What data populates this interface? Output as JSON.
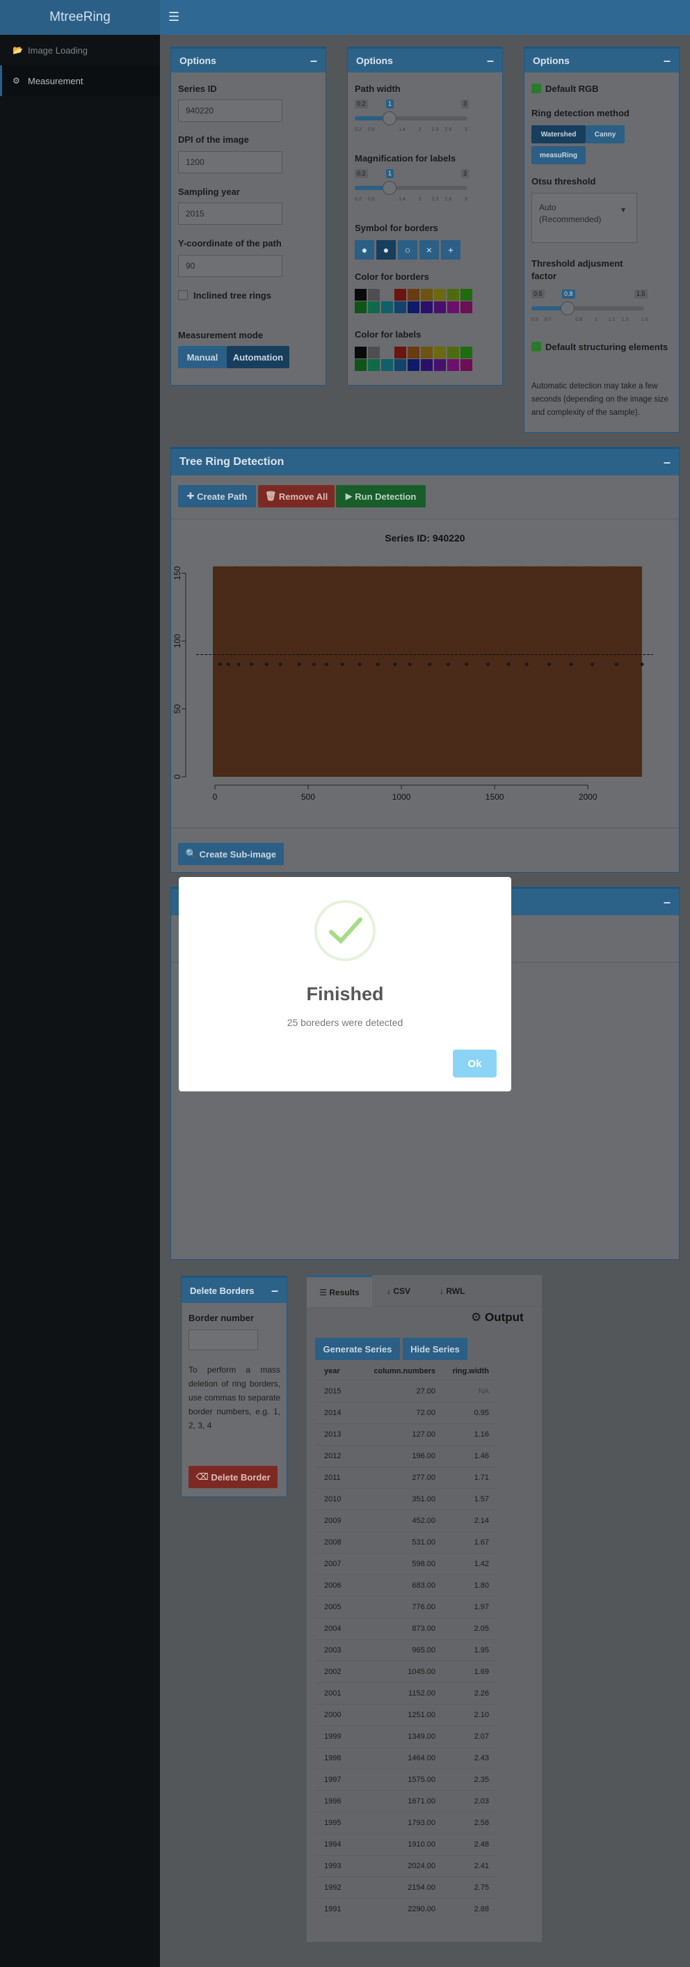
{
  "app": {
    "title": "MtreeRing"
  },
  "sidebar": {
    "items": [
      {
        "label": "Image Loading",
        "icon": "folder-open-icon"
      },
      {
        "label": "Measurement",
        "icon": "gear-icon"
      }
    ]
  },
  "options1": {
    "title": "Options",
    "series_id_label": "Series ID",
    "series_id": "940220",
    "dpi_label": "DPI of the image",
    "dpi": "1200",
    "year_label": "Sampling year",
    "year": "2015",
    "ycoord_label": "Y-coordinate of the path",
    "ycoord": "90",
    "inclined_label": "Inclined tree rings",
    "mode_label": "Measurement mode",
    "mode_manual": "Manual",
    "mode_auto": "Automation"
  },
  "options2": {
    "title": "Options",
    "path_width_label": "Path width",
    "pw_min": "0.2",
    "pw_val": "1",
    "pw_max": "3",
    "pw_ticks": [
      "0.2",
      "0.5",
      "1.4",
      "2",
      "2.3",
      "2.6",
      "3"
    ],
    "mag_label": "Magnification for labels",
    "mag_min": "0.2",
    "mag_val": "1",
    "mag_max": "3",
    "mag_ticks": [
      "0.2",
      "0.5",
      "1.4",
      "2",
      "2.3",
      "2.6",
      "3"
    ],
    "symbol_label": "Symbol for borders",
    "symbols": [
      "●",
      "●",
      "○",
      "×",
      "+"
    ],
    "border_color_label": "Color for borders",
    "label_color_label": "Color for labels"
  },
  "options3": {
    "title": "Options",
    "default_rgb": "Default RGB",
    "method_label": "Ring detection method",
    "methods": [
      "Watershed",
      "Canny",
      "measuRing"
    ],
    "otsu_label": "Otsu threshold",
    "otsu_value": "Auto\n(Recommended)",
    "thr_label": "Threshold adjusment factor",
    "thr_min": "0.5",
    "thr_val": "0.8",
    "thr_max": "1.5",
    "thr_ticks": [
      "0.5",
      "0.7",
      "0.9",
      "1",
      "1.1",
      "1.3",
      "1.5"
    ],
    "struct_label": "Default structuring elements",
    "note": "Automatic detection may take a few seconds (depending on the image size and complexity of the sample)."
  },
  "detection": {
    "title": "Tree Ring Detection",
    "create_path": "Create Path",
    "remove_all": "Remove All",
    "run": "Run Detection",
    "sub_image": "Create Sub-image"
  },
  "chart_data": {
    "type": "scatter",
    "title": "Series ID: 940220",
    "xlabel": "",
    "ylabel": "",
    "xlim": [
      0,
      2350
    ],
    "ylim": [
      0,
      160
    ],
    "xticks": [
      "0",
      "500",
      "1000",
      "1500",
      "2000"
    ],
    "yticks": [
      "0",
      "50",
      "100",
      "150"
    ],
    "path_y": 90,
    "border_x": [
      27,
      72,
      127,
      196,
      277,
      351,
      452,
      531,
      598,
      683,
      776,
      873,
      965,
      1045,
      1152,
      1251,
      1349,
      1464,
      1575,
      1671,
      1793,
      1910,
      2024,
      2154,
      2290
    ]
  },
  "modal": {
    "title": "Finished",
    "message": "25 boreders were detected",
    "ok": "Ok"
  },
  "delete": {
    "title": "Delete Borders",
    "border_label": "Border number",
    "help": "To perform a mass deletion of ring borders, use commas to separate border numbers, e.g. 1, 2, 3, 4",
    "button": "Delete Border"
  },
  "results": {
    "tabs": [
      "Results",
      "CSV",
      "RWL"
    ],
    "output_label": "Output",
    "generate": "Generate Series",
    "hide": "Hide Series",
    "headers": [
      "year",
      "column.numbers",
      "ring.width"
    ],
    "rows": [
      [
        "2015",
        "27.00",
        "NA"
      ],
      [
        "2014",
        "72.00",
        "0.95"
      ],
      [
        "2013",
        "127.00",
        "1.16"
      ],
      [
        "2012",
        "196.00",
        "1.46"
      ],
      [
        "2011",
        "277.00",
        "1.71"
      ],
      [
        "2010",
        "351.00",
        "1.57"
      ],
      [
        "2009",
        "452.00",
        "2.14"
      ],
      [
        "2008",
        "531.00",
        "1.67"
      ],
      [
        "2007",
        "598.00",
        "1.42"
      ],
      [
        "2006",
        "683.00",
        "1.80"
      ],
      [
        "2005",
        "776.00",
        "1.97"
      ],
      [
        "2004",
        "873.00",
        "2.05"
      ],
      [
        "2003",
        "965.00",
        "1.95"
      ],
      [
        "2002",
        "1045.00",
        "1.69"
      ],
      [
        "2001",
        "1152.00",
        "2.26"
      ],
      [
        "2000",
        "1251.00",
        "2.10"
      ],
      [
        "1999",
        "1349.00",
        "2.07"
      ],
      [
        "1998",
        "1464.00",
        "2.43"
      ],
      [
        "1997",
        "1575.00",
        "2.35"
      ],
      [
        "1996",
        "1671.00",
        "2.03"
      ],
      [
        "1995",
        "1793.00",
        "2.58"
      ],
      [
        "1994",
        "1910.00",
        "2.48"
      ],
      [
        "1993",
        "2024.00",
        "2.41"
      ],
      [
        "1992",
        "2154.00",
        "2.75"
      ],
      [
        "1991",
        "2290.00",
        "2.88"
      ]
    ]
  },
  "colors": {
    "accent": "#3c8dbc",
    "success": "#a5dc86",
    "border_palette": [
      "#000000",
      "#777777",
      "#ffffff",
      "#ff0000",
      "#ff7f00",
      "#ffbf00",
      "#ffff00",
      "#bfff00",
      "#00ff00",
      "#00ff7f",
      "#00ffff",
      "#0080ff",
      "#0000ff",
      "#4000ff",
      "#8000ff",
      "#ff00ff"
    ]
  }
}
